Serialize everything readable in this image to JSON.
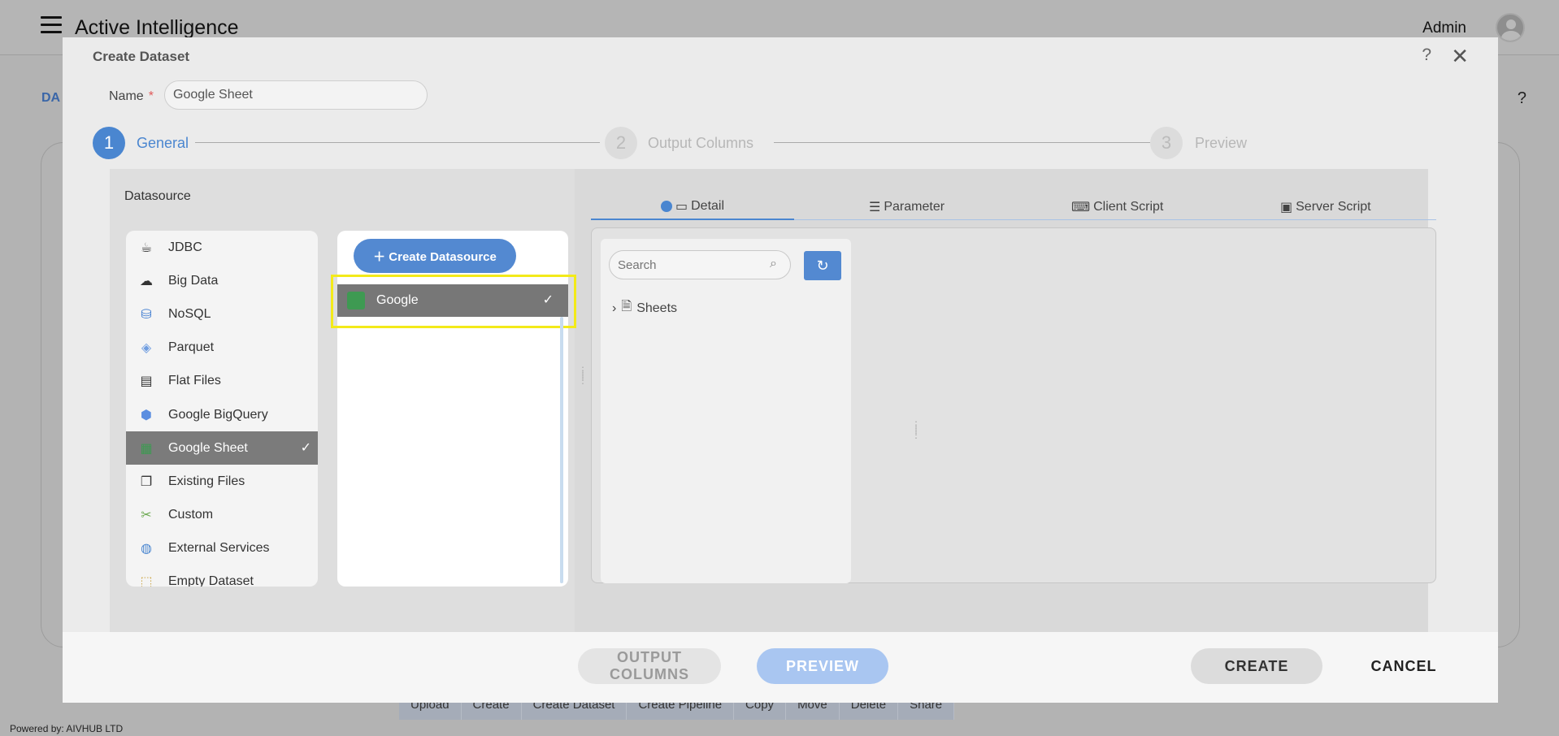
{
  "app": {
    "title": "Active Intelligence",
    "user": "Admin",
    "bg_section": "DA",
    "bg_help": "?",
    "powered_by": "Powered by: AIVHUB LTD"
  },
  "bg_toolbar": [
    "Upload",
    "Create",
    "Create Dataset",
    "Create Pipeline",
    "Copy",
    "Move",
    "Delete",
    "Share"
  ],
  "modal": {
    "title": "Create Dataset",
    "help": "?",
    "close": "✕",
    "name_label": "Name",
    "required_mark": "*",
    "name_value": "Google Sheet"
  },
  "steps": [
    {
      "number": "1",
      "label": "General",
      "active": true
    },
    {
      "number": "2",
      "label": "Output Columns",
      "active": false
    },
    {
      "number": "3",
      "label": "Preview",
      "active": false
    }
  ],
  "datasource": {
    "label": "Datasource",
    "items": [
      {
        "label": "JDBC",
        "icon": "jdbc-icon"
      },
      {
        "label": "Big Data",
        "icon": "big-data-icon"
      },
      {
        "label": "NoSQL",
        "icon": "nosql-icon"
      },
      {
        "label": "Parquet",
        "icon": "parquet-icon"
      },
      {
        "label": "Flat Files",
        "icon": "flat-files-icon"
      },
      {
        "label": "Google BigQuery",
        "icon": "bigquery-icon"
      },
      {
        "label": "Google Sheet",
        "icon": "google-sheet-icon",
        "selected": true
      },
      {
        "label": "Existing Files",
        "icon": "existing-files-icon"
      },
      {
        "label": "Custom",
        "icon": "custom-icon"
      },
      {
        "label": "External Services",
        "icon": "globe-icon"
      },
      {
        "label": "Empty Dataset",
        "icon": "empty-dataset-icon"
      }
    ],
    "create_button": "Create Datasource",
    "sources": [
      {
        "label": "Google",
        "selected": true
      }
    ]
  },
  "tabs": [
    {
      "label": "Detail",
      "active": true
    },
    {
      "label": "Parameter",
      "active": false
    },
    {
      "label": "Client Script",
      "active": false
    },
    {
      "label": "Server Script",
      "active": false
    }
  ],
  "detail": {
    "search_placeholder": "Search",
    "tree": [
      {
        "label": "Sheets"
      }
    ]
  },
  "footer": {
    "output_columns": "OUTPUT COLUMNS",
    "preview": "PREVIEW",
    "create": "CREATE",
    "cancel": "CANCEL"
  },
  "colors": {
    "accent": "#4a86d0",
    "highlight": "#f3ea19",
    "selected_bg": "#7b7b7b"
  }
}
